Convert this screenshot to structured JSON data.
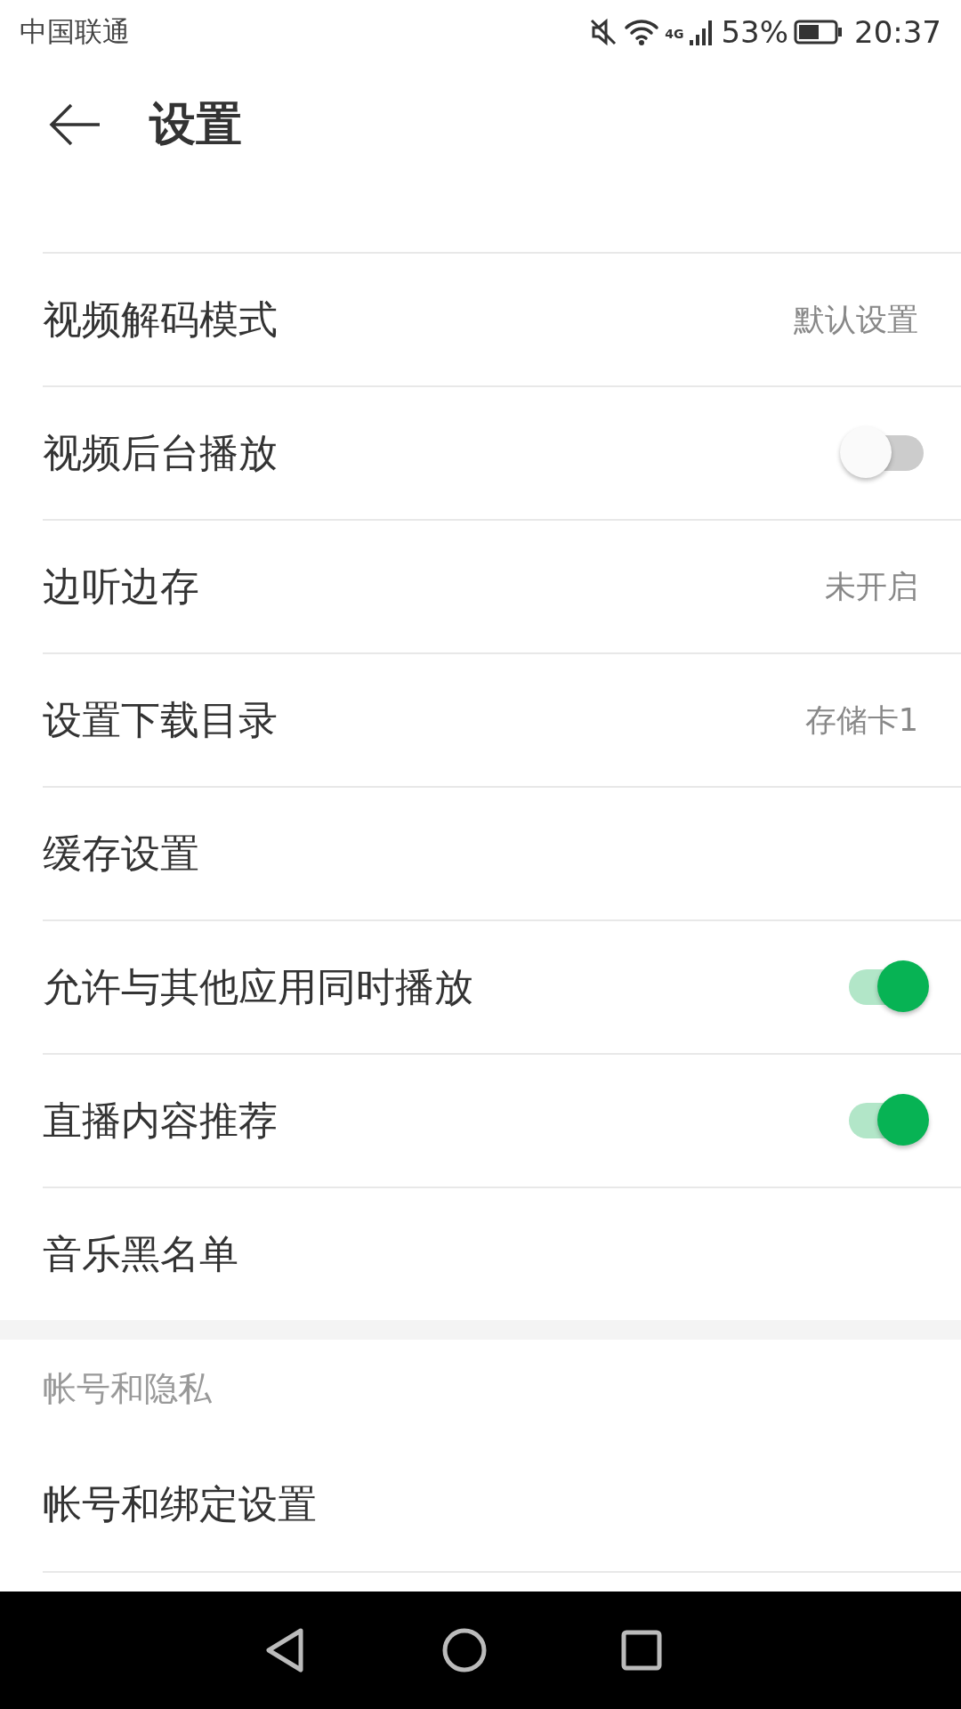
{
  "status_bar": {
    "carrier": "中国联通",
    "network": "4G",
    "battery": "53%",
    "time": "20:37"
  },
  "header": {
    "title": "设置"
  },
  "rows": [
    {
      "kind": "value",
      "label": "视频解码模式",
      "value": "默认设置"
    },
    {
      "kind": "toggle",
      "label": "视频后台播放",
      "on": false
    },
    {
      "kind": "value",
      "label": "边听边存",
      "value": "未开启"
    },
    {
      "kind": "value",
      "label": "设置下载目录",
      "value": "存储卡1"
    },
    {
      "kind": "plain",
      "label": "缓存设置"
    },
    {
      "kind": "toggle",
      "label": "允许与其他应用同时播放",
      "on": true
    },
    {
      "kind": "toggle",
      "label": "直播内容推荐",
      "on": true
    },
    {
      "kind": "plain",
      "label": "音乐黑名单"
    }
  ],
  "section": {
    "title": "帐号和隐私",
    "rows": [
      {
        "label": "帐号和绑定设置"
      }
    ]
  }
}
